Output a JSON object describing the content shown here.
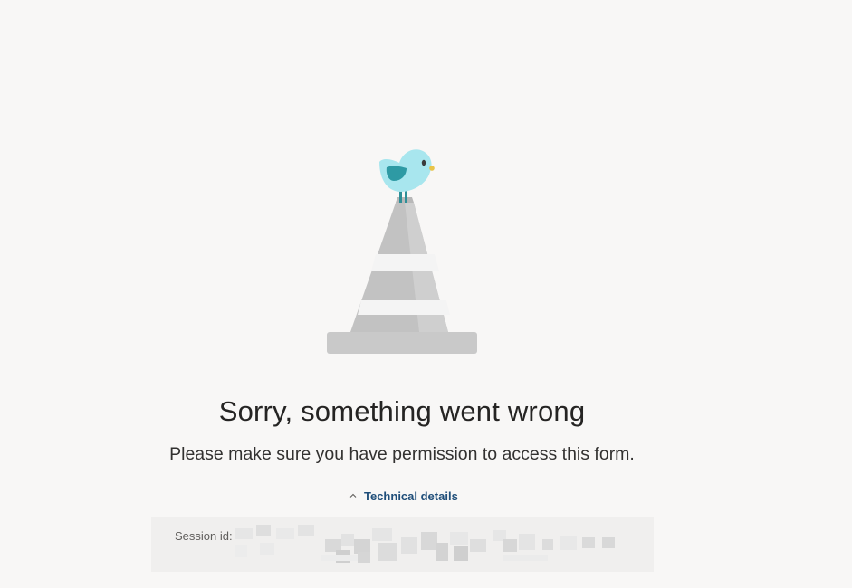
{
  "error": {
    "title": "Sorry, something went wrong",
    "message": "Please make sure you have permission to access this form."
  },
  "technical_details": {
    "toggle_label": "Technical details",
    "expanded": true,
    "session_label": "Session id:",
    "session_value_redacted": true
  },
  "colors": {
    "background": "#f8f7f6",
    "panel": "#f0efee",
    "link": "#1f4e79",
    "bird_body": "#a8e6ee",
    "bird_wing": "#2e9aa4",
    "cone_gray": "#c7c7c7",
    "cone_stripe": "#f2f2f2"
  },
  "icons": {
    "illustration": "bird-on-traffic-cone-icon",
    "toggle": "chevron-up-icon"
  }
}
